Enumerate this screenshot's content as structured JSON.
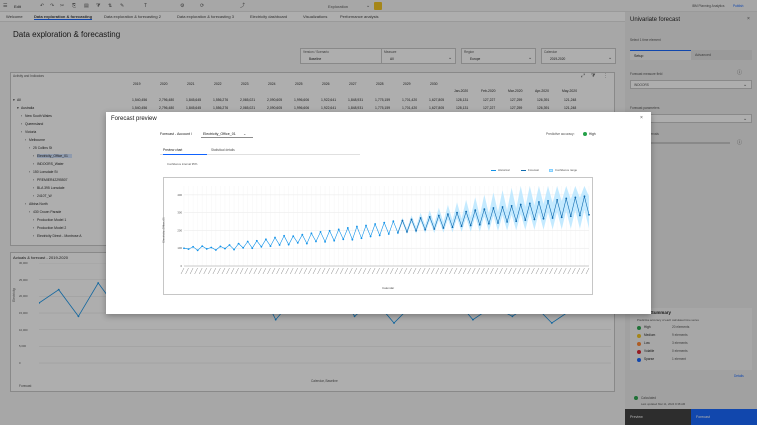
{
  "topbar": {
    "app_name": "Edit",
    "document_title": "Exploration",
    "right_links": [
      "IBM Planning Analytics",
      "Publish"
    ]
  },
  "tabs": [
    "Welcome",
    "Data exploration & forecasting",
    "Data exploration & forecasting 2",
    "Data exploration & forecasting 3",
    "Electricity dashboard",
    "Visualizations",
    "Performance analysis"
  ],
  "page_title": "Data exploration & forecasting",
  "filters": [
    {
      "label": "Version / Scenario",
      "value": "Baseline"
    },
    {
      "label": "Measure",
      "value": "All"
    },
    {
      "label": "Region",
      "value": "Europe"
    },
    {
      "label": "Calendar",
      "value": "2019-2020"
    }
  ],
  "crosstab": {
    "title": "Activity and Indicators",
    "year_headers": [
      "2019",
      "2020",
      "2021",
      "2022",
      "2023",
      "2024",
      "2025",
      "2026",
      "2027",
      "2028",
      "2029",
      "2030"
    ],
    "month_headers": [
      "Jan-2020",
      "Feb-2020",
      "Mar-2020",
      "Apr-2020",
      "May-2020"
    ],
    "rows": [
      {
        "label": "All",
        "values": [
          "1,540,456",
          "2,796,480",
          "1,845,645",
          "1,556,276",
          "2,065,021",
          "2,090,605",
          "1,996,606",
          "1,922,641",
          "1,848,931",
          "1,775,159",
          "1,701,420",
          "1,627,805",
          "128,131",
          "127,227",
          "127,259",
          "126,391",
          "121,248"
        ]
      },
      {
        "label": "Australia",
        "values": [
          "1,540,456",
          "2,796,480",
          "1,845,645",
          "1,556,276",
          "2,065,021",
          "2,090,605",
          "1,996,606",
          "1,922,641",
          "1,848,931",
          "1,775,159",
          "1,701,420",
          "1,627,805",
          "128,131",
          "127,227",
          "127,259",
          "126,391",
          "121,248"
        ]
      },
      {
        "label": "New South Wales",
        "values": []
      },
      {
        "label": "Queensland",
        "values": []
      },
      {
        "label": "Victoria",
        "values": []
      },
      {
        "label": "Melbourne",
        "values": []
      },
      {
        "label": "25 Collins St",
        "values": []
      },
      {
        "label": "Electricity_Office_01",
        "values": []
      },
      {
        "label": "INDOORS_Water",
        "values": []
      },
      {
        "label": "150 Lonsdale St",
        "values": []
      },
      {
        "label": "PREMIER42295507",
        "values": []
      },
      {
        "label": "BLA 395 Lonsdale",
        "values": []
      },
      {
        "label": "2410T_W",
        "values": []
      },
      {
        "label": "Albina North",
        "values": []
      },
      {
        "label": "430 Crown Parade",
        "values": []
      },
      {
        "label": "Production Model 1",
        "values": []
      },
      {
        "label": "Production Model 2",
        "values": []
      },
      {
        "label": "Electricity Direct - Montrose A",
        "values": []
      }
    ]
  },
  "bg_chart": {
    "title": "Actuals & forecast - 2019-2020",
    "ylabel": "Electricity",
    "xlabel": "Calendar, Baseline",
    "yticks": [
      "30,000",
      "25,000",
      "20,000",
      "15,000",
      "10,000",
      "5,000",
      "0"
    ],
    "legend": "Forecast"
  },
  "right_panel": {
    "title": "Univariate forecast",
    "subtitle": "Select 1 time element",
    "tabs": [
      "Setup",
      "Advanced"
    ],
    "forecast_field_label": "Forecast measure field",
    "forecast_field_value": "INDOORS",
    "params_label": "Forecast parameters",
    "confidence_label": "Confidence intervals",
    "summary_title": "Model Summary",
    "summary_sub": "Predictive accuracy of each calculated time series",
    "summary_items": [
      {
        "label": "High",
        "count": "20 elements",
        "color": "#24a148"
      },
      {
        "label": "Medium",
        "count": "9 elements",
        "color": "#f1c21b"
      },
      {
        "label": "Low",
        "count": "3 elements",
        "color": "#ff832b"
      },
      {
        "label": "Volatile",
        "count": "0 elements",
        "color": "#da1e28"
      },
      {
        "label": "Sparse",
        "count": "1 element",
        "color": "#0f62fe"
      }
    ],
    "details_link": "Details",
    "status_text": "Calculated",
    "status_time": "Last updated Mar 11, 2024 9:38 AM",
    "preview_button": "Preview",
    "forecast_button": "Forecast"
  },
  "modal": {
    "title": "Forecast preview",
    "forecast_label": "Forecast - Account /",
    "forecast_value": "Electricity_Office_01",
    "accuracy_label": "Predictive accuracy:",
    "accuracy_value": "High",
    "accuracy_color": "#24a148",
    "tabs": [
      "Preview chart",
      "Statistical details"
    ],
    "confidence_text": "Confidence interval 95%",
    "legend": [
      "Historical",
      "Forecast",
      "Confidence range"
    ],
    "ylabel": "Electricity_Office_01",
    "xlabel": "Calendar"
  },
  "chart_data": {
    "type": "line",
    "title": "",
    "xlabel": "Calendar",
    "ylabel": "Electricity_Office_01",
    "ylim": [
      0,
      450
    ],
    "yticks": [
      "0",
      "100",
      "200",
      "300",
      "400"
    ],
    "series": [
      {
        "name": "Historical",
        "color": "#1192e8",
        "values": [
          100,
          95,
          108,
          88,
          112,
          96,
          104,
          90,
          110,
          98,
          118,
          92,
          126,
          102,
          138,
          100,
          142,
          108,
          150,
          112,
          160,
          118,
          170,
          120,
          168,
          130,
          176,
          126,
          184,
          138,
          192,
          136,
          198,
          142,
          206,
          150,
          214,
          148,
          222,
          156,
          228,
          166,
          236,
          172,
          244,
          180,
          252,
          186
        ]
      },
      {
        "name": "Forecast",
        "color": "#0e6bb0",
        "values": [
          256,
          192,
          262,
          198,
          270,
          204,
          276,
          208,
          284,
          214,
          292,
          218,
          300,
          224,
          306,
          228,
          314,
          232,
          320,
          238,
          326,
          242,
          332,
          248,
          338,
          252,
          346,
          258,
          352,
          262,
          360,
          266,
          366,
          270,
          372,
          274,
          380,
          280,
          386,
          284,
          392,
          288
        ]
      },
      {
        "name": "Confidence range",
        "color": "#bae6ff"
      }
    ],
    "grid": true,
    "legend_position": "top-right"
  }
}
